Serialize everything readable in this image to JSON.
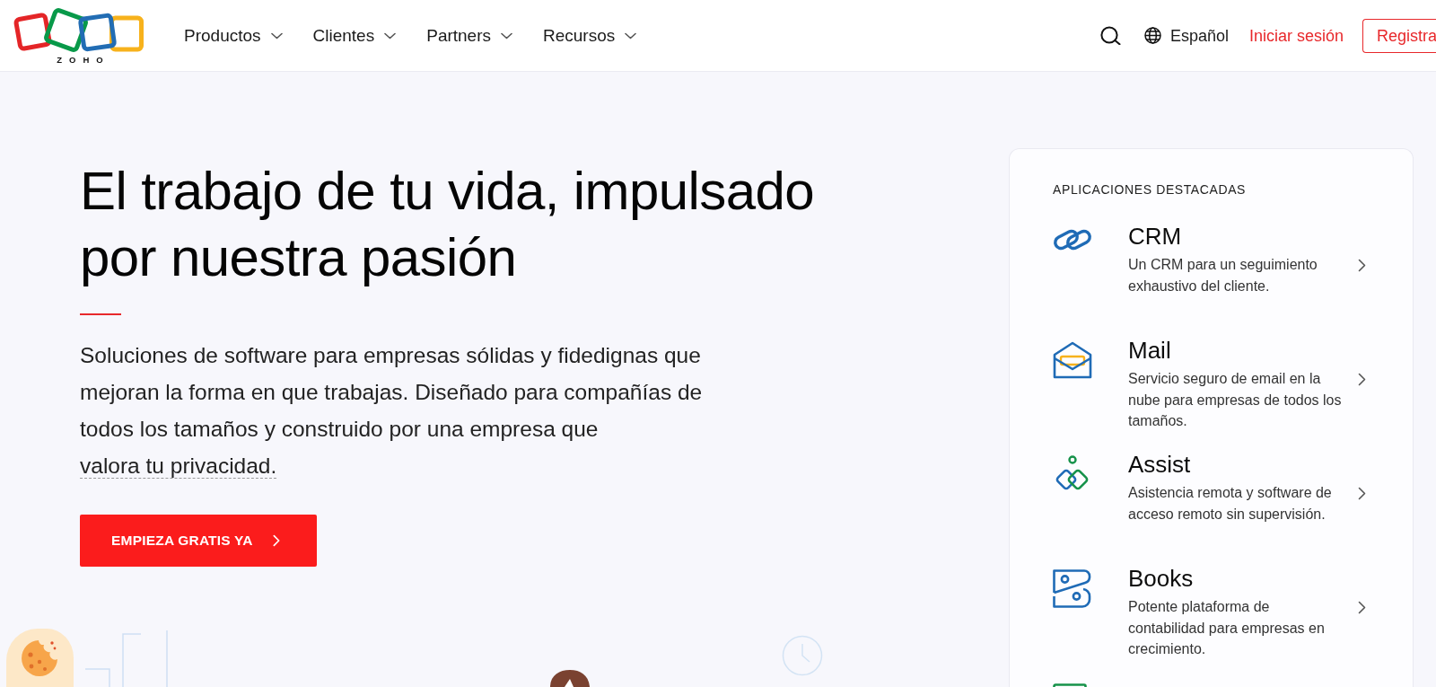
{
  "header": {
    "logo_text": "ZOHO",
    "nav": [
      "Productos",
      "Clientes",
      "Partners",
      "Recursos"
    ],
    "language": "Español",
    "sign_in": "Iniciar sesión",
    "sign_up": "Registra"
  },
  "hero": {
    "title": "El trabajo de tu vida, impulsado por nuestra pasión",
    "intro": "Soluciones de software para empresas sólidas y fidedignas que mejoran la forma en que trabajas. Diseñado para compañías de todos los tamaños y construido por una empresa que",
    "intro_link": "valora tu privacidad.",
    "cta": "EMPIEZA GRATIS YA"
  },
  "featured_apps": {
    "heading": "APLICACIONES DESTACADAS",
    "apps": [
      {
        "name": "CRM",
        "description": "Un CRM para un seguimiento exhaustivo del cliente."
      },
      {
        "name": "Mail",
        "description": "Servicio seguro de email en la nube para empresas de todos los tamaños."
      },
      {
        "name": "Assist",
        "description": "Asistencia remota y software de acceso remoto sin supervisión."
      },
      {
        "name": "Books",
        "description": "Potente plataforma de contabilidad para empresas en crecimiento."
      }
    ]
  }
}
